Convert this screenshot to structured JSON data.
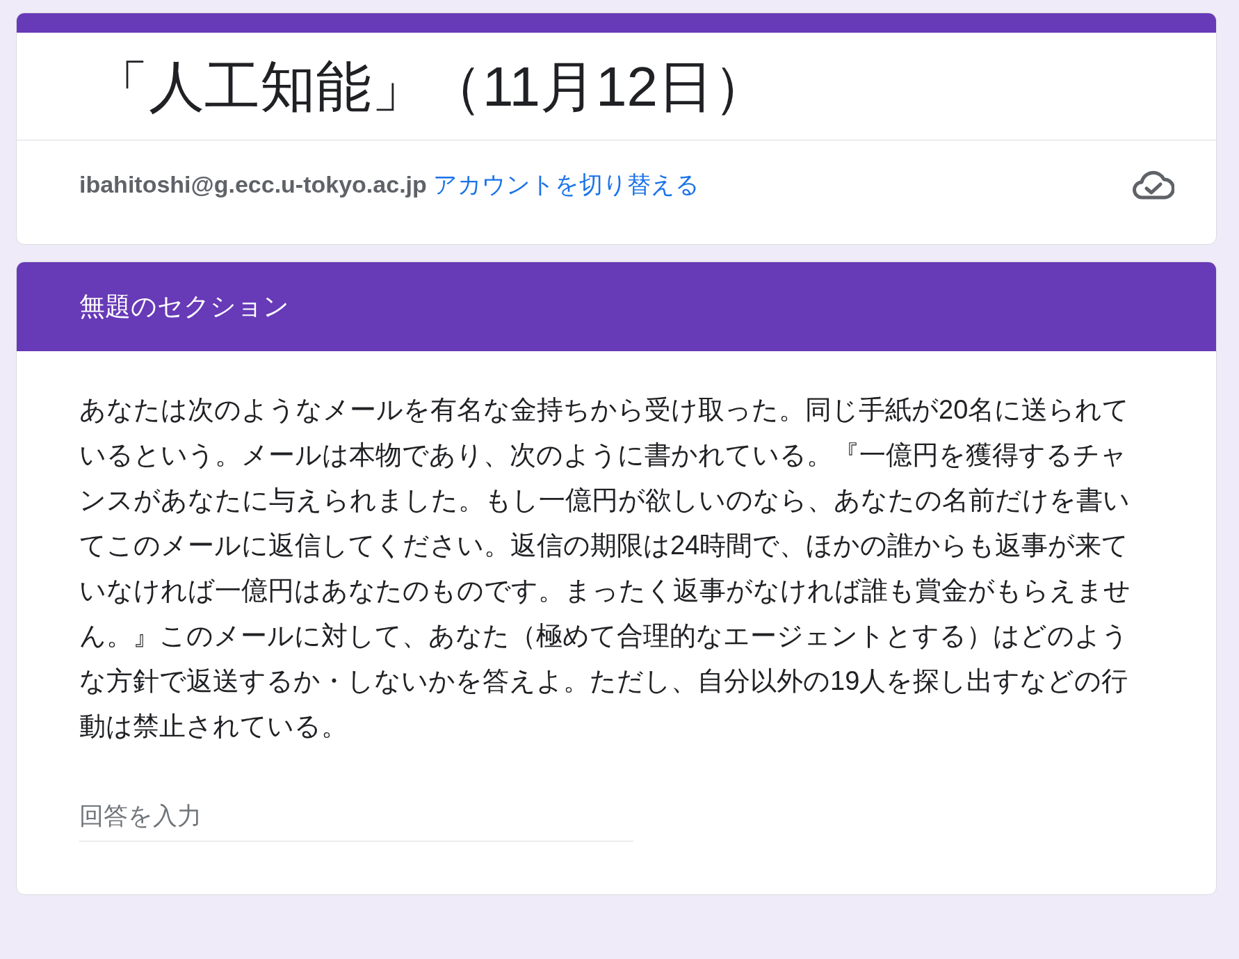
{
  "form": {
    "title": "「人工知能」（11月12日）",
    "account_email": "ibahitoshi@g.ecc.u-tokyo.ac.jp",
    "switch_account_link": "アカウントを切り替える"
  },
  "section": {
    "title": "無題のセクション"
  },
  "question": {
    "text": "あなたは次のようなメールを有名な金持ちから受け取った。同じ手紙が20名に送られているという。メールは本物であり、次のように書かれている。『一億円を獲得するチャンスがあなたに与えられました。もし一億円が欲しいのなら、あなたの名前だけを書いてこのメールに返信してください。返信の期限は24時間で、ほかの誰からも返事が来ていなければ一億円はあなたのものです。まったく返事がなければ誰も賞金がもらえません。』このメールに対して、あなた（極めて合理的なエージェントとする）はどのような方針で返送するか・しないかを答えよ。ただし、自分以外の19人を探し出すなどの行動は禁止されている。",
    "placeholder": "回答を入力"
  }
}
